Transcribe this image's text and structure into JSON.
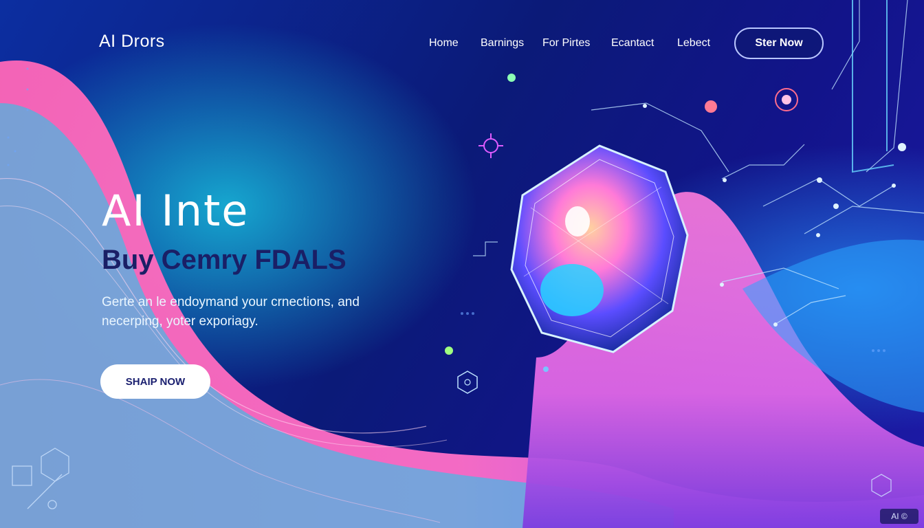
{
  "header": {
    "logo": "AI Drors",
    "nav": [
      "Home",
      "Barnings",
      "For Pirtes",
      "Ecantact",
      "Lebect"
    ],
    "cta_label": "Ster Now"
  },
  "hero": {
    "title": "AI Inte",
    "subtitle_regular": "Buy Cemry ",
    "subtitle_bold": "FDALS",
    "description": "Gerte an le endoymand your crnections, and necerping, yoter exporiagy.",
    "button_label": "SHAIP NOW"
  },
  "corner_tag": "AI ©",
  "colors": {
    "accent_pink": "#ff5fb5",
    "accent_cyan": "#1fd6f2",
    "deep_blue": "#0b1a78",
    "violet": "#b44dff"
  }
}
